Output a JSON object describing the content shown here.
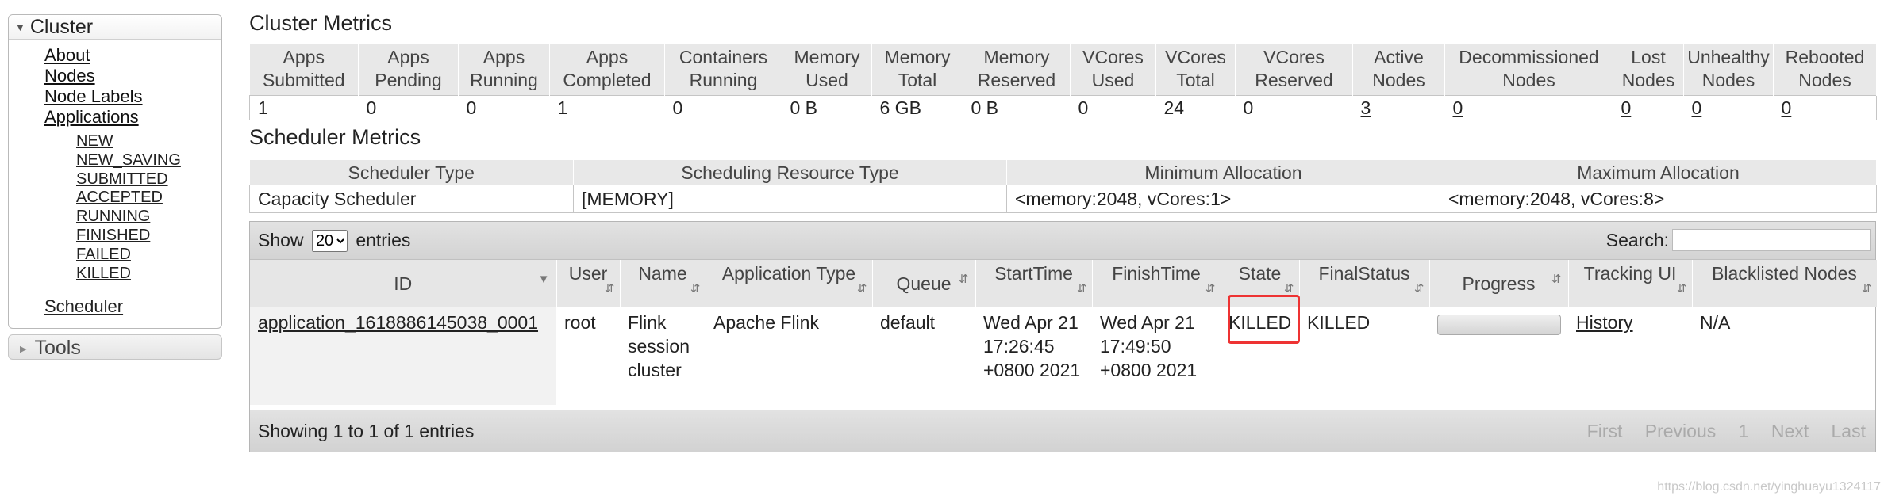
{
  "nav": {
    "cluster_title": "Cluster",
    "links": [
      "About",
      "Nodes",
      "Node Labels",
      "Applications"
    ],
    "app_states": [
      "NEW",
      "NEW_SAVING",
      "SUBMITTED",
      "ACCEPTED",
      "RUNNING",
      "FINISHED",
      "FAILED",
      "KILLED"
    ],
    "scheduler": "Scheduler",
    "tools_title": "Tools"
  },
  "cluster_metrics": {
    "title": "Cluster Metrics",
    "headers": [
      [
        "Apps",
        "Submitted"
      ],
      [
        "Apps",
        "Pending"
      ],
      [
        "Apps",
        "Running"
      ],
      [
        "Apps",
        "Completed"
      ],
      [
        "Containers",
        "Running"
      ],
      [
        "Memory",
        "Used"
      ],
      [
        "Memory",
        "Total"
      ],
      [
        "Memory",
        "Reserved"
      ],
      [
        "VCores",
        "Used"
      ],
      [
        "VCores",
        "Total"
      ],
      [
        "VCores",
        "Reserved"
      ],
      [
        "Active",
        "Nodes"
      ],
      [
        "Decommissioned",
        "Nodes"
      ],
      [
        "Lost",
        "Nodes"
      ],
      [
        "Unhealthy",
        "Nodes"
      ],
      [
        "Rebooted",
        "Nodes"
      ]
    ],
    "values": [
      "1",
      "0",
      "0",
      "1",
      "0",
      "0 B",
      "6 GB",
      "0 B",
      "0",
      "24",
      "0",
      "3",
      "0",
      "0",
      "0",
      "0"
    ]
  },
  "scheduler_metrics": {
    "title": "Scheduler Metrics",
    "headers": [
      "Scheduler Type",
      "Scheduling Resource Type",
      "Minimum Allocation",
      "Maximum Allocation"
    ],
    "values": [
      "Capacity Scheduler",
      "[MEMORY]",
      "<memory:2048, vCores:1>",
      "<memory:2048, vCores:8>"
    ]
  },
  "apps_table": {
    "show_label": "Show",
    "entries_label": "entries",
    "page_size": "20",
    "search_label": "Search:",
    "search_value": "",
    "columns": [
      [
        "ID",
        ""
      ],
      [
        "User",
        ""
      ],
      [
        "Name",
        ""
      ],
      [
        "Application Type",
        ""
      ],
      [
        "Queue",
        ""
      ],
      [
        "StartTime",
        ""
      ],
      [
        "FinishTime",
        ""
      ],
      [
        "State",
        ""
      ],
      [
        "FinalStatus",
        ""
      ],
      [
        "Progress",
        ""
      ],
      [
        "Tracking UI",
        ""
      ],
      [
        "Blacklisted Nodes",
        ""
      ]
    ],
    "rows": [
      {
        "id": "application_1618886145038_0001",
        "user": "root",
        "name": "Flink session cluster",
        "type": "Apache Flink",
        "queue": "default",
        "start": "Wed Apr 21 17:26:45 +0800 2021",
        "finish": "Wed Apr 21 17:49:50 +0800 2021",
        "state": "KILLED",
        "final_status": "KILLED",
        "progress": 0,
        "tracking_ui": "History",
        "blacklisted": "N/A"
      }
    ],
    "info": "Showing 1 to 1 of 1 entries",
    "pager": [
      "First",
      "Previous",
      "1",
      "Next",
      "Last"
    ]
  },
  "watermark": "https://blog.csdn.net/yinghuayu1324117"
}
